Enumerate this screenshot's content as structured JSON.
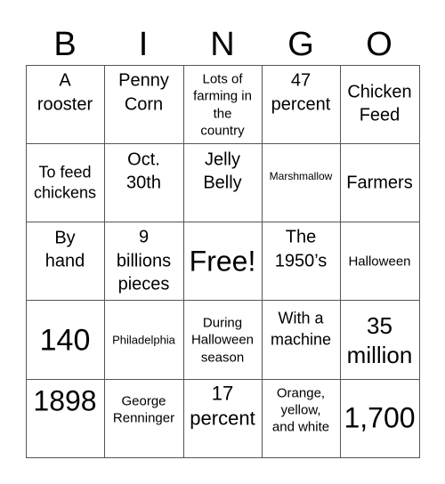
{
  "card": {
    "header": [
      "B",
      "I",
      "N",
      "G",
      "O"
    ],
    "cells": [
      [
        {
          "lines": [
            "A",
            "rooster"
          ]
        },
        {
          "lines": [
            "Penny",
            "Corn"
          ]
        },
        {
          "lines": [
            "Lots of",
            "farming in",
            "the",
            "country"
          ]
        },
        {
          "lines": [
            "47",
            "percent"
          ]
        },
        {
          "lines": [
            "Chicken",
            "Feed"
          ]
        }
      ],
      [
        {
          "lines": [
            "To feed",
            "chickens"
          ]
        },
        {
          "lines": [
            "Oct.",
            "30th"
          ]
        },
        {
          "lines": [
            "Jelly",
            "Belly"
          ]
        },
        {
          "lines": [
            "Marshmallow"
          ]
        },
        {
          "lines": [
            "Farmers"
          ]
        }
      ],
      [
        {
          "lines": [
            "By",
            "hand"
          ]
        },
        {
          "lines": [
            "9",
            "billions",
            "pieces"
          ]
        },
        {
          "lines": [
            "Free!"
          ],
          "free_space": true
        },
        {
          "lines": [
            "The",
            "1950’s"
          ]
        },
        {
          "lines": [
            "Halloween"
          ]
        }
      ],
      [
        {
          "lines": [
            "140"
          ]
        },
        {
          "lines": [
            "Philadelphia"
          ]
        },
        {
          "lines": [
            "During",
            "Halloween",
            "season"
          ]
        },
        {
          "lines": [
            "With a",
            "machine"
          ]
        },
        {
          "lines": [
            "35",
            "million"
          ]
        }
      ],
      [
        {
          "lines": [
            "1898"
          ]
        },
        {
          "lines": [
            "George",
            "Renninger"
          ]
        },
        {
          "lines": [
            "17",
            "percent"
          ]
        },
        {
          "lines": [
            "Orange,",
            "yellow,",
            "and white"
          ]
        },
        {
          "lines": [
            "1,700"
          ]
        }
      ]
    ]
  }
}
